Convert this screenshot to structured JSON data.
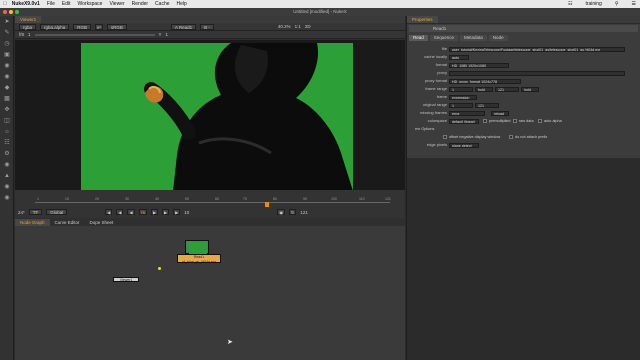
{
  "menubar": {
    "app": "NukeX9.0v1",
    "items": [
      "File",
      "Edit",
      "Workspace",
      "Viewer",
      "Render",
      "Cache",
      "Help"
    ],
    "user": "training"
  },
  "window": {
    "title": "Untitled [modified] - NukeX"
  },
  "toolbar": {
    "icons": [
      "pointer-icon",
      "draw-icon",
      "time-icon",
      "channel-icon",
      "color-icon",
      "filter-icon",
      "keyer-icon",
      "merge-icon",
      "transform-icon",
      "3d-icon",
      "views-icon",
      "metadata-icon",
      "toolsets-icon",
      "other-icon",
      "furnace-icon",
      "ocula-icon",
      "boke-icon"
    ]
  },
  "viewer": {
    "tab": "Viewer1",
    "channels": "rgba",
    "alpha": "rgba.alpha",
    "mode": "RGB",
    "ip": "IP",
    "colorspace": "sRGB",
    "a_input": "A Read1",
    "b_input": "B -",
    "gain": "f/8",
    "gain_val": "1",
    "zoom_fit": "40.2%",
    "ratio": "1:1",
    "view": "2D",
    "exposure_label": "Y",
    "exposure_val": "1",
    "info": "HD_1080 1920x1080  bbox: 0 0 1920 1080 channels: rgb",
    "coord": "x=-35 y=22"
  },
  "timeline": {
    "ticks": [
      "1",
      "10",
      "20",
      "30",
      "40",
      "50",
      "60",
      "70",
      "80",
      "90",
      "100",
      "110",
      "121"
    ],
    "fps": "24*",
    "tf": "TF",
    "global": "Global",
    "frame": "76",
    "increment": "10",
    "end": "121"
  },
  "nodegraph": {
    "tabs": [
      "Node Graph",
      "Curve Editor",
      "Dope Sheet"
    ],
    "read_label": "Read1",
    "read_sub": "pf_shot_gs_%04d.exr",
    "viewer_label": "Viewer1"
  },
  "properties": {
    "title": "Properties",
    "node": "Read1",
    "tabs": [
      "Read",
      "Sequence",
      "Metadata",
      "Node"
    ],
    "fields": {
      "file_label": "file",
      "file_value": "user_tutorial/KeyingTelescope/Footage/telescope_shot01_gs/telescope_shot01_gs.%04d.exr",
      "cache_label": "cache locally",
      "cache_value": "auto",
      "format_label": "format",
      "format_value": "HD_1080 1920x1080",
      "proxy_label": "proxy",
      "proxyfmt_label": "proxy format",
      "proxyfmt_value": "HD_proxy_format 1024x778",
      "range_label": "frame range",
      "range_start": "1",
      "range_mode1": "hold",
      "range_end": "121",
      "range_mode2": "hold",
      "frame_label": "frame",
      "frame_value": "expression",
      "orig_label": "original range",
      "orig_start": "1",
      "orig_end": "121",
      "missing_label": "missing frames",
      "missing_value": "error",
      "reload": "reload",
      "colorspace_label": "colorspace",
      "colorspace_value": "default (linear)",
      "premult": "premultiplied",
      "rawdata": "raw data",
      "autoalpha": "auto alpha",
      "exr_label": "exr Options",
      "offset_neg": "offset negative display window",
      "no_prefix": "do not attach prefix",
      "edge_label": "edge pixels",
      "edge_value": "plane detect"
    }
  }
}
